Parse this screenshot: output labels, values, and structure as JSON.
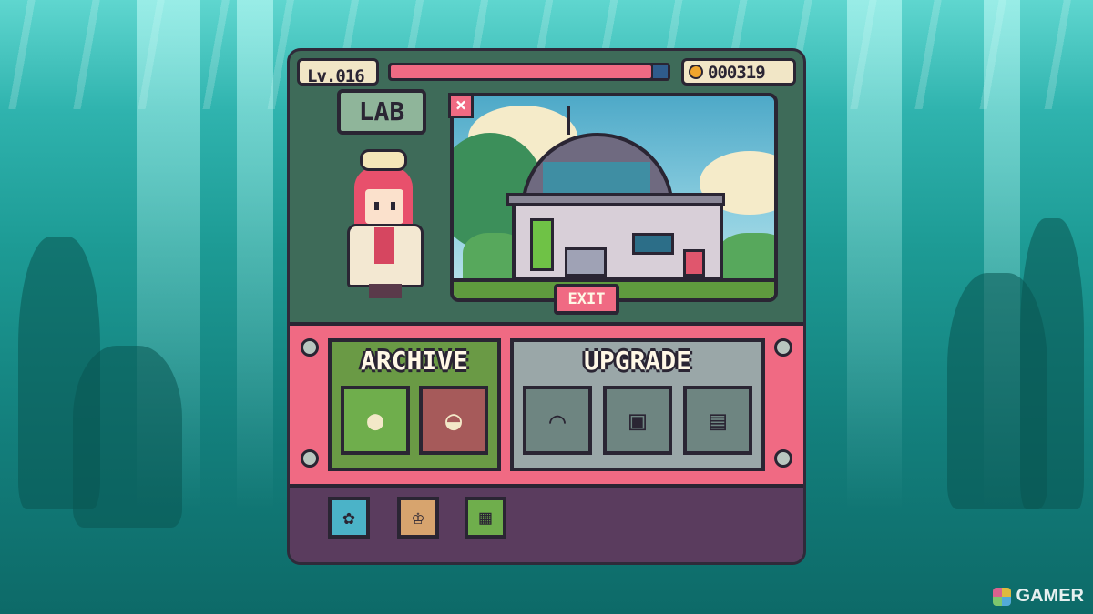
{
  "hud": {
    "level": "Lv.016",
    "xp_fraction": 0.94,
    "coins": "000319",
    "coin_icon": "coin-icon"
  },
  "location": {
    "label": "LAB"
  },
  "scene": {
    "exit_label": "EXIT",
    "close_label": "×"
  },
  "archive": {
    "title": "ARCHIVE",
    "slots": [
      "chick-icon",
      "bread-icon"
    ]
  },
  "upgrade": {
    "title": "UPGRADE",
    "slots": [
      "microscope-icon",
      "container-icon",
      "machine-icon"
    ]
  },
  "bottom_bar": {
    "buttons": [
      "gear-icon",
      "trophy-icon",
      "save-icon"
    ]
  },
  "watermark": {
    "text": "GAMER"
  },
  "colors": {
    "accent_pink": "#f06a83",
    "panel_green": "#3e6b59",
    "bottom_purple": "#5a3c5e"
  }
}
